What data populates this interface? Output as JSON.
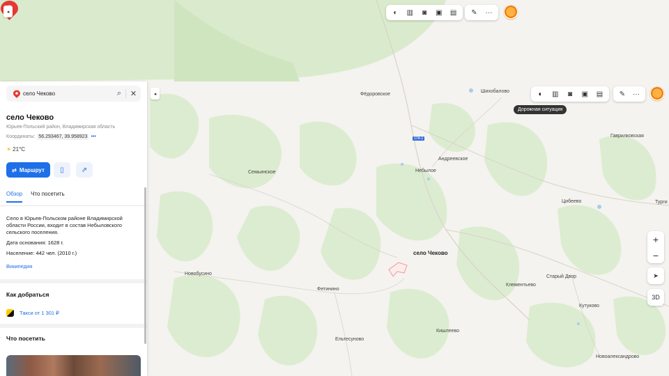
{
  "map": {
    "places": [
      {
        "name": "Фёдоровское"
      },
      {
        "name": "Шихобалово"
      },
      {
        "name": "Гаврилковская"
      },
      {
        "name": "Андреевское"
      },
      {
        "name": "Небылое"
      },
      {
        "name": "Семьинское"
      },
      {
        "name": "Цибеево"
      },
      {
        "name": "Турги"
      },
      {
        "name": "Новобусино"
      },
      {
        "name": "Фетинино"
      },
      {
        "name": "Клементьево"
      },
      {
        "name": "Старый Двор"
      },
      {
        "name": "Кутуково"
      },
      {
        "name": "Кишлеево"
      },
      {
        "name": "Ельтесуново"
      },
      {
        "name": "Новоалександрово"
      }
    ],
    "road_shield": "17А-1",
    "pin_label": "село Чеково"
  },
  "toolbar": {
    "icons": [
      "layers-icon",
      "atlas-icon",
      "panorama-icon",
      "transit-icon",
      "traffic-icon",
      "ruler-icon",
      "more-icon"
    ],
    "more": "···",
    "tooltip": "Дорожная ситуация"
  },
  "controls": {
    "zoom_in": "+",
    "zoom_out": "−",
    "three_d": "3D",
    "collapse": "◂"
  },
  "panel": {
    "search_query": "село Чеково",
    "title": "село Чеково",
    "subtitle": "Юрьев-Польский район, Владимирская область",
    "coords_label": "Координаты:",
    "coords_value": "56.293467, 39.958923",
    "coords_more": "•••",
    "weather": "21°C",
    "route_button": "Маршрут",
    "tabs": [
      {
        "label": "Обзор",
        "active": true
      },
      {
        "label": "Что посетить",
        "active": false
      }
    ],
    "description": "Село в Юрьев-Польском районе Владимирской области России, входит в состав Небыловского сельского поселения.",
    "founded_label": "Дата основания:",
    "founded_value": "1628 г.",
    "population_label": "Население:",
    "population_value": "442 чел. (2010 г.)",
    "wiki_link": "Википедия",
    "how_to_get": "Как добраться",
    "taxi": "Такси от 1 301 ₽",
    "what_to_visit": "Что посетить"
  },
  "colors": {
    "accent": "#1e6fe8",
    "pin": "#e53935",
    "forest": "#dcecd0"
  }
}
